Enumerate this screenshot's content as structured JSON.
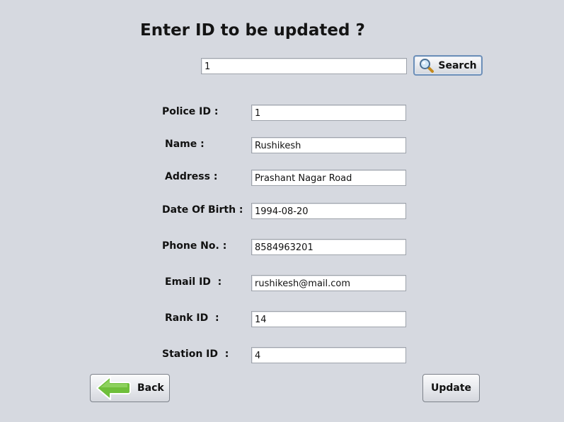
{
  "heading": "Enter ID to be updated ?",
  "search": {
    "value": "1",
    "button_label": "Search"
  },
  "form": {
    "fields": [
      {
        "label": "Police ID :",
        "value": "1"
      },
      {
        "label": "Name :",
        "value": "Rushikesh"
      },
      {
        "label": "Address :",
        "value": "Prashant Nagar Road"
      },
      {
        "label": "Date Of Birth :",
        "value": "1994-08-20"
      },
      {
        "label": "Phone No. :",
        "value": "8584963201"
      },
      {
        "label": "Email ID  :",
        "value": "rushikesh@mail.com"
      },
      {
        "label": "Rank ID  :",
        "value": "14"
      },
      {
        "label": "Station ID  :",
        "value": "4"
      }
    ]
  },
  "actions": {
    "back_label": "Back",
    "update_label": "Update"
  },
  "icons": {
    "search": "magnifier-icon",
    "back": "green-arrow-left-icon"
  },
  "colors": {
    "background": "#d6d9e0",
    "back_arrow": "#6fbf3a",
    "search_button_border": "#6d8fb8"
  }
}
